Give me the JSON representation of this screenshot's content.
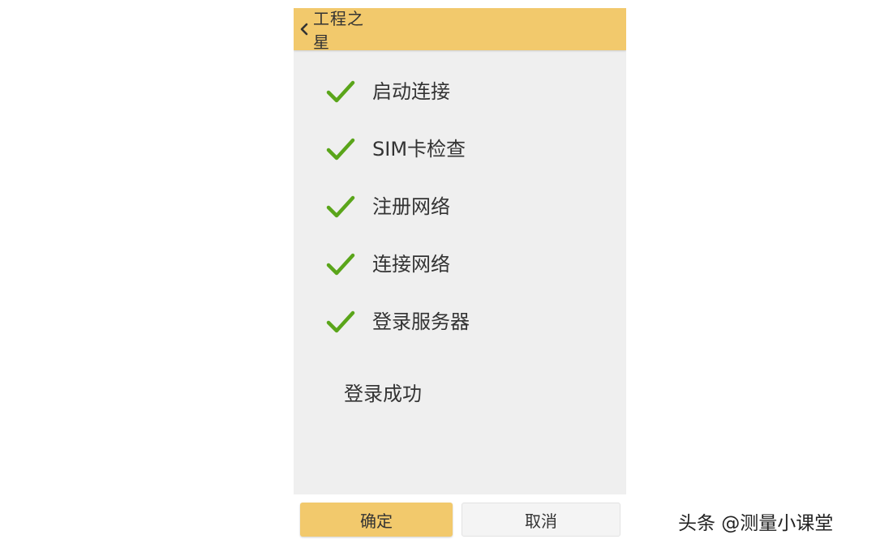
{
  "header": {
    "back_icon": "chevron-left-icon",
    "title": "工程之星"
  },
  "steps": [
    {
      "label": "启动连接",
      "status": "done",
      "icon": "check-icon"
    },
    {
      "label": "SIM卡检查",
      "status": "done",
      "icon": "check-icon"
    },
    {
      "label": "注册网络",
      "status": "done",
      "icon": "check-icon"
    },
    {
      "label": "连接网络",
      "status": "done",
      "icon": "check-icon"
    },
    {
      "label": "登录服务器",
      "status": "done",
      "icon": "check-icon"
    }
  ],
  "result_text": "登录成功",
  "footer": {
    "confirm_label": "确定",
    "cancel_label": "取消"
  },
  "watermark": "头条 @测量小课堂",
  "colors": {
    "accent": "#f2c96c",
    "check": "#5aa51a",
    "background": "#efefef",
    "text": "#333333"
  }
}
